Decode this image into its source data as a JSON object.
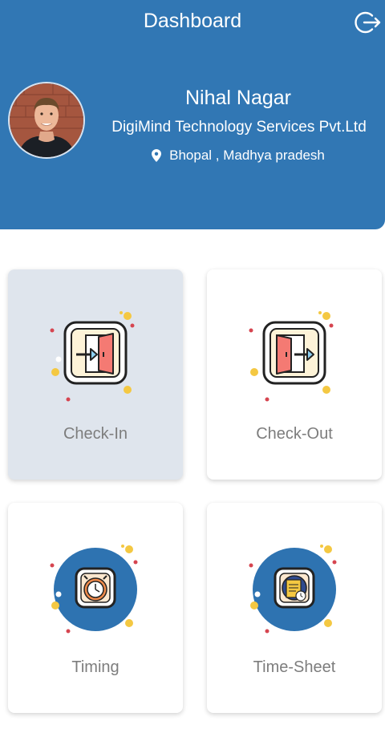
{
  "header": {
    "title": "Dashboard",
    "logout_icon": "logout-icon",
    "background_color": "#3177b4"
  },
  "profile": {
    "name": "Nihal Nagar",
    "company": "DigiMind Technology Services Pvt.Ltd",
    "location": "Bhopal , Madhya pradesh",
    "location_icon": "map-pin-icon"
  },
  "cards": [
    {
      "label": "Check-In",
      "icon": "check-in-door-icon",
      "active": true
    },
    {
      "label": "Check-Out",
      "icon": "check-out-door-icon",
      "active": false
    },
    {
      "label": "Timing",
      "icon": "alarm-clock-icon",
      "active": false
    },
    {
      "label": "Time-Sheet",
      "icon": "timesheet-icon",
      "active": false
    }
  ]
}
